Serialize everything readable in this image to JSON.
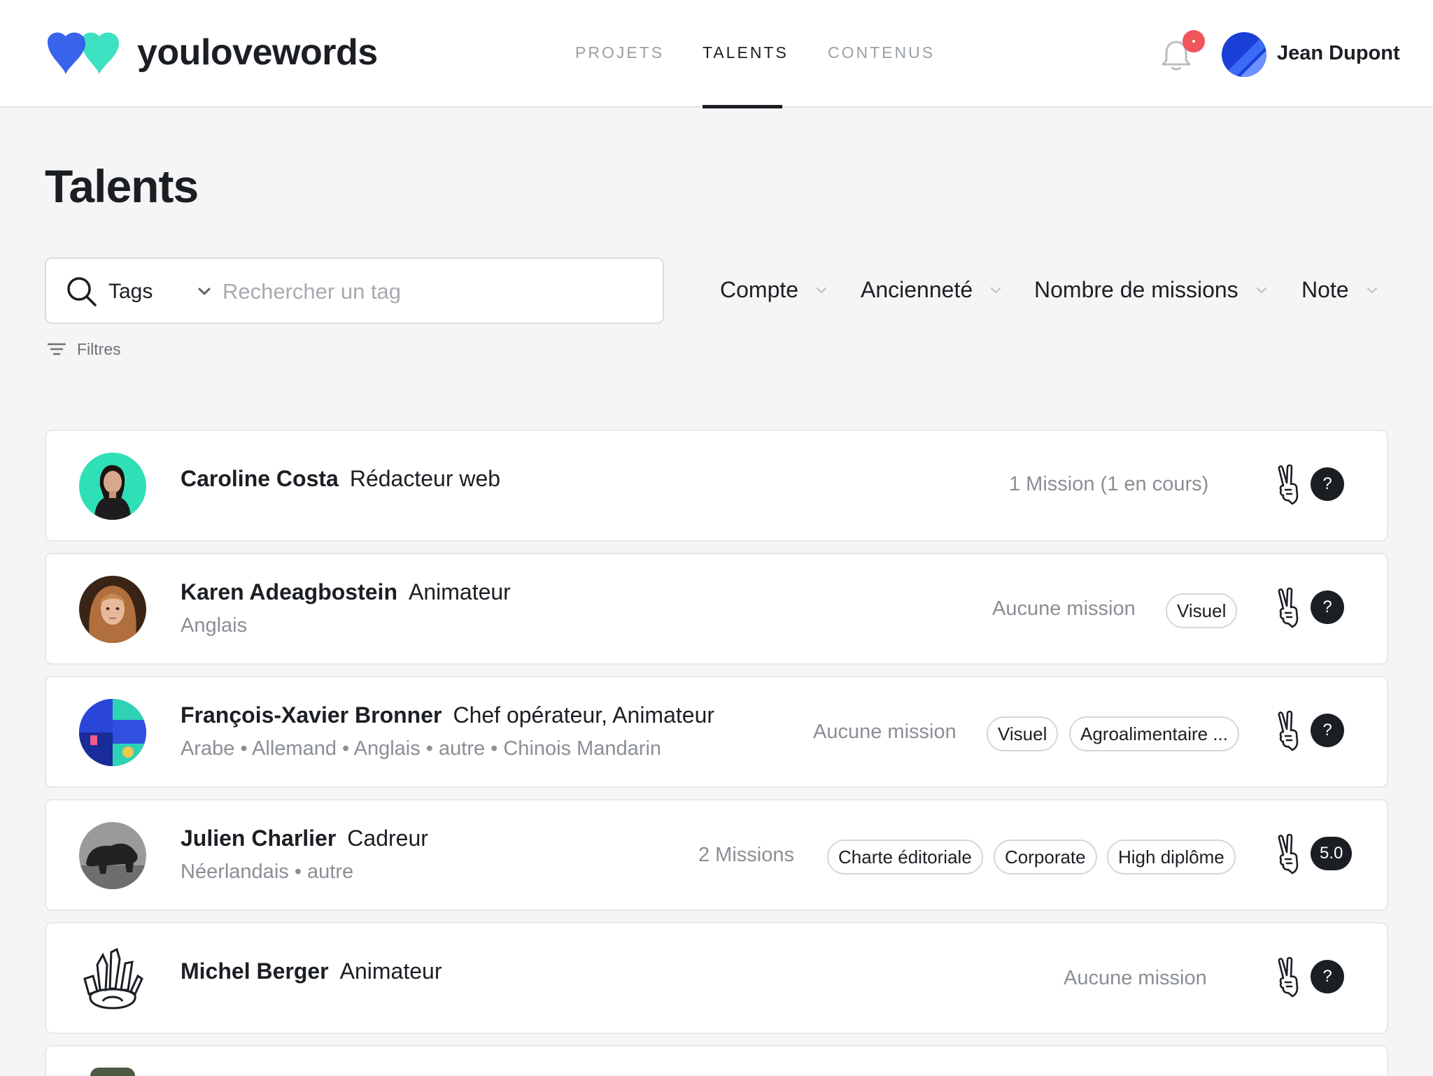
{
  "brand": {
    "name": "youlovewords",
    "colors": {
      "blue": "#2f5bea",
      "mint": "#3de0c0",
      "text": "#1b1f24",
      "muted": "#8a8f95",
      "notification": "#f2545b"
    }
  },
  "nav": {
    "tabs": [
      {
        "label": "PROJETS"
      },
      {
        "label": "TALENTS"
      },
      {
        "label": "CONTENUS"
      }
    ],
    "active": "TALENTS"
  },
  "user": {
    "name": "Jean Dupont"
  },
  "page": {
    "title": "Talents"
  },
  "search": {
    "tags_label": "Tags",
    "placeholder": "Rechercher un tag"
  },
  "filters": {
    "dropdowns": [
      {
        "label": "Compte"
      },
      {
        "label": "Ancienneté"
      },
      {
        "label": "Nombre de missions"
      },
      {
        "label": "Note"
      }
    ],
    "filtres_label": "Filtres"
  },
  "talents": [
    {
      "name": "Caroline Costa",
      "role": "Rédacteur web",
      "languages": "",
      "missions": "1 Mission (1 en cours)",
      "tags": [],
      "rating": "?"
    },
    {
      "name": "Karen Adeagbostein",
      "role": "Animateur",
      "languages": "Anglais",
      "missions": "Aucune mission",
      "tags": [
        "Visuel"
      ],
      "rating": "?"
    },
    {
      "name": "François-Xavier Bronner",
      "role": "Chef opérateur, Animateur",
      "languages": "Arabe • Allemand • Anglais • autre • Chinois Mandarin",
      "missions": "Aucune mission",
      "tags": [
        "Visuel",
        "Agroalimentaire ..."
      ],
      "rating": "?"
    },
    {
      "name": "Julien Charlier",
      "role": "Cadreur",
      "languages": "Néerlandais • autre",
      "missions": "2 Missions",
      "tags": [
        "Charte éditoriale",
        "Corporate",
        "High diplôme"
      ],
      "rating": "5.0"
    },
    {
      "name": "Michel Berger",
      "role": "Animateur",
      "languages": "",
      "missions": "Aucune mission",
      "tags": [],
      "rating": "?"
    }
  ]
}
